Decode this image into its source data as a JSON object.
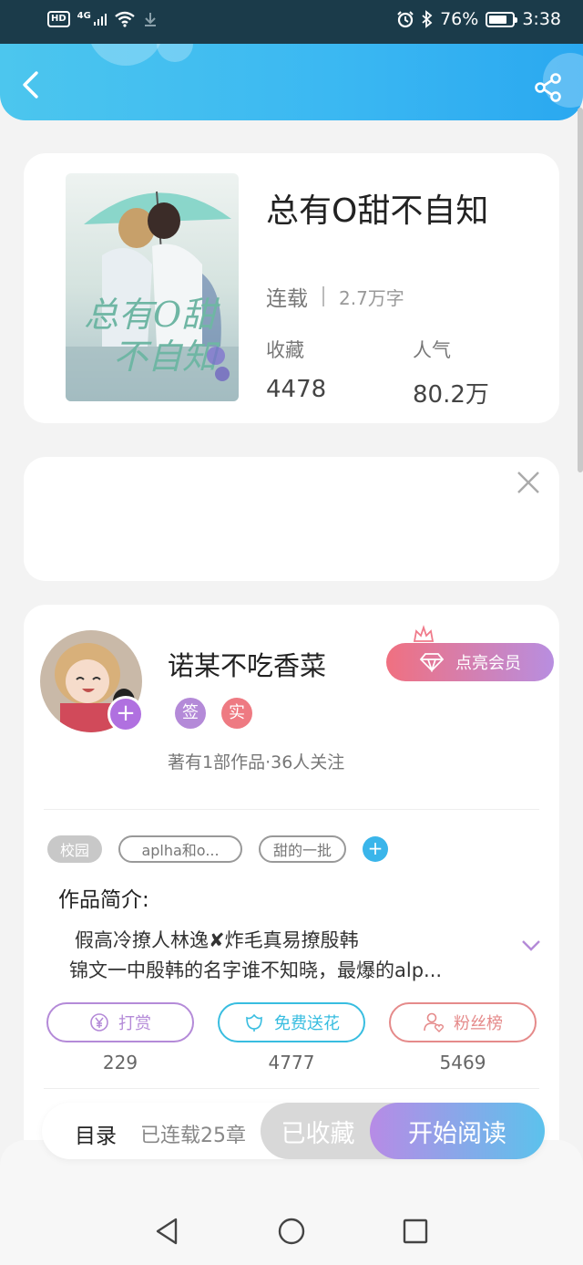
{
  "status_bar": {
    "hd": "HD",
    "network": "4G",
    "battery_percent": "76%",
    "battery_level": 0.76,
    "time": "3:38",
    "icons": [
      "wifi-icon",
      "download-icon",
      "alarm-icon",
      "bluetooth-icon",
      "battery-icon"
    ]
  },
  "header": {
    "back_icon": "chevron-left-icon",
    "share_icon": "share-icon",
    "color": "#3ab7f2"
  },
  "book": {
    "title": "总有O甜不自知",
    "cover_title": "总有O甜不自知",
    "status": "连载",
    "word_count": "2.7万字",
    "favorites_label": "收藏",
    "favorites_value": "4478",
    "popularity_label": "人气",
    "popularity_value": "80.2万"
  },
  "ad": {
    "close_icon": "close-icon"
  },
  "author": {
    "name": "诺某不吃香菜",
    "vip_label": "点亮会员",
    "badge_sign": "签",
    "badge_real": "实",
    "stats": "著有1部作品·36人关注"
  },
  "tags": {
    "items": [
      "校园",
      "aplha和o...",
      "甜的一批"
    ],
    "add_icon": "plus-icon"
  },
  "intro": {
    "label": "作品简介:",
    "line1": "假高冷撩人林逸✘炸毛真易撩殷韩",
    "line2": "锦文一中殷韩的名字谁不知晓，最爆的alp..."
  },
  "actions": {
    "reward_label": "打赏",
    "reward_count": "229",
    "flower_label": "免费送花",
    "flower_count": "4777",
    "fans_label": "粉丝榜",
    "fans_count": "5469"
  },
  "bottom_bar": {
    "toc_label": "目录",
    "chapters": "已连载25章",
    "favorited_label": "已收藏",
    "read_label": "开始阅读"
  },
  "colors": {
    "accent_blue": "#3ab5ea",
    "reward_purple": "#b48ad8",
    "flower_cyan": "#38bde0",
    "fans_red": "#e58a8a",
    "vip_gradient_start": "#f07080",
    "vip_gradient_end": "#b88ee0"
  }
}
